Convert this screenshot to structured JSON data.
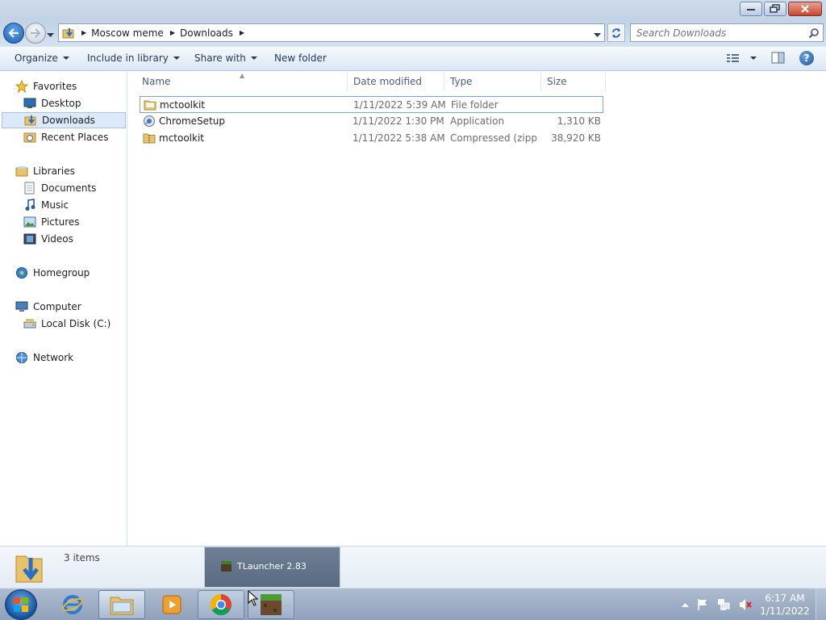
{
  "window": {
    "minimize_label": "Minimize",
    "maximize_label": "Restore",
    "close_label": "Close"
  },
  "address_bar": {
    "crumbs": [
      "Moscow meme",
      "Downloads"
    ]
  },
  "search": {
    "placeholder": "Search Downloads"
  },
  "toolbar": {
    "organize": "Organize",
    "include_in_library": "Include in library",
    "share_with": "Share with",
    "new_folder": "New folder"
  },
  "nav": {
    "favorites": "Favorites",
    "desktop": "Desktop",
    "downloads": "Downloads",
    "recent_places": "Recent Places",
    "libraries": "Libraries",
    "documents": "Documents",
    "music": "Music",
    "pictures": "Pictures",
    "videos": "Videos",
    "homegroup": "Homegroup",
    "computer": "Computer",
    "local_disk": "Local Disk (C:)",
    "network": "Network"
  },
  "columns": {
    "name": "Name",
    "date": "Date modified",
    "type": "Type",
    "size": "Size"
  },
  "files": [
    {
      "name": "mctoolkit",
      "date": "1/11/2022 5:39 AM",
      "type": "File folder",
      "size": "",
      "icon": "folder-icon"
    },
    {
      "name": "ChromeSetup",
      "date": "1/11/2022 1:30 PM",
      "type": "Application",
      "size": "1,310 KB",
      "icon": "installer-icon"
    },
    {
      "name": "mctoolkit",
      "date": "1/11/2022 5:38 AM",
      "type": "Compressed (zipp...",
      "size": "38,920 KB",
      "icon": "zip-folder-icon"
    }
  ],
  "details": {
    "count": "3 items"
  },
  "thumbnail": {
    "title": "TLauncher 2.83"
  },
  "clock": {
    "time": "6:17 AM",
    "date": "1/11/2022"
  },
  "colors": {
    "accent": "#1e395b",
    "selection": "#dbe9f8",
    "taskbar": "#9aabc3"
  }
}
